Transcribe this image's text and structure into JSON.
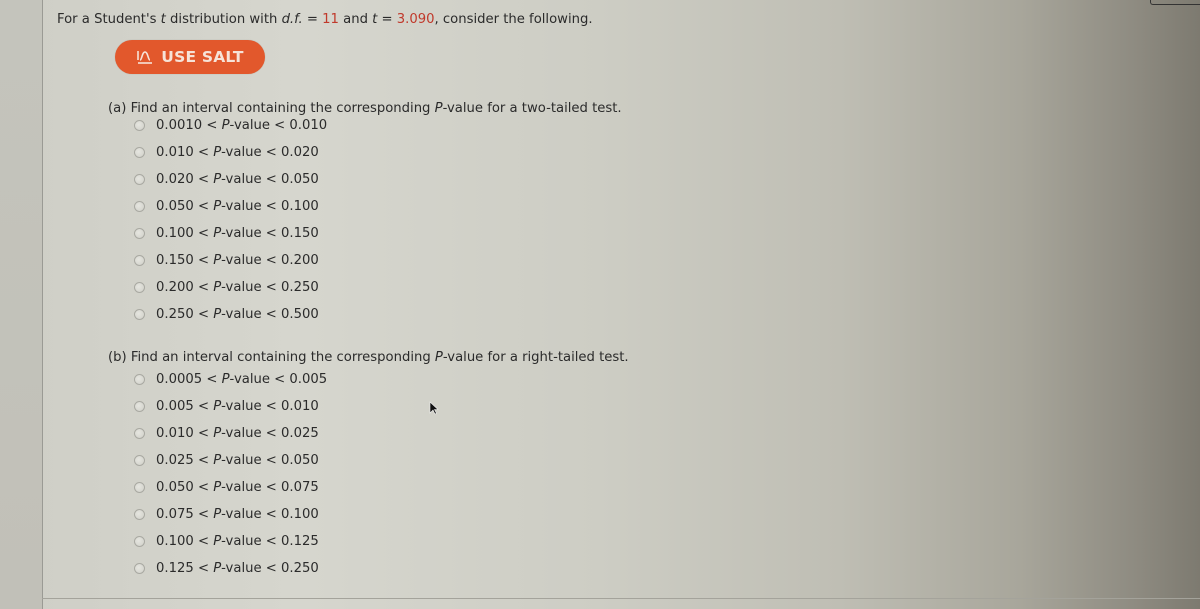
{
  "intro": {
    "prefix": "For a Student's ",
    "t_symbol": "t",
    "mid1": " distribution with ",
    "df_symbol": "d.f.",
    "eq1": " = ",
    "df_value": "11",
    "and": " and ",
    "t_symbol2": "t",
    "eq2": " = ",
    "t_value": "3.090",
    "suffix": ", consider the following."
  },
  "salt_button": {
    "label": "USE SALT",
    "icon": "salt-curve-icon",
    "color": "#e2582c"
  },
  "part_a": {
    "prefix": "(a) Find an interval containing the corresponding ",
    "p_symbol": "P",
    "suffix": "-value for a two-tailed test.",
    "options": [
      {
        "low": "0.0010",
        "high": "0.010"
      },
      {
        "low": "0.010",
        "high": "0.020"
      },
      {
        "low": "0.020",
        "high": "0.050"
      },
      {
        "low": "0.050",
        "high": "0.100"
      },
      {
        "low": "0.100",
        "high": "0.150"
      },
      {
        "low": "0.150",
        "high": "0.200"
      },
      {
        "low": "0.200",
        "high": "0.250"
      },
      {
        "low": "0.250",
        "high": "0.500"
      }
    ]
  },
  "part_b": {
    "prefix": "(b) Find an interval containing the corresponding ",
    "p_symbol": "P",
    "suffix": "-value for a right-tailed test.",
    "options": [
      {
        "low": "0.0005",
        "high": "0.005"
      },
      {
        "low": "0.005",
        "high": "0.010"
      },
      {
        "low": "0.010",
        "high": "0.025"
      },
      {
        "low": "0.025",
        "high": "0.050"
      },
      {
        "low": "0.050",
        "high": "0.075"
      },
      {
        "low": "0.075",
        "high": "0.100"
      },
      {
        "low": "0.100",
        "high": "0.125"
      },
      {
        "low": "0.125",
        "high": "0.250"
      }
    ]
  },
  "option_labels": {
    "lt": " < ",
    "p_symbol": "P",
    "value_word": "-value"
  },
  "colors": {
    "accent_red": "#c0392b",
    "button_orange": "#e2582c"
  }
}
